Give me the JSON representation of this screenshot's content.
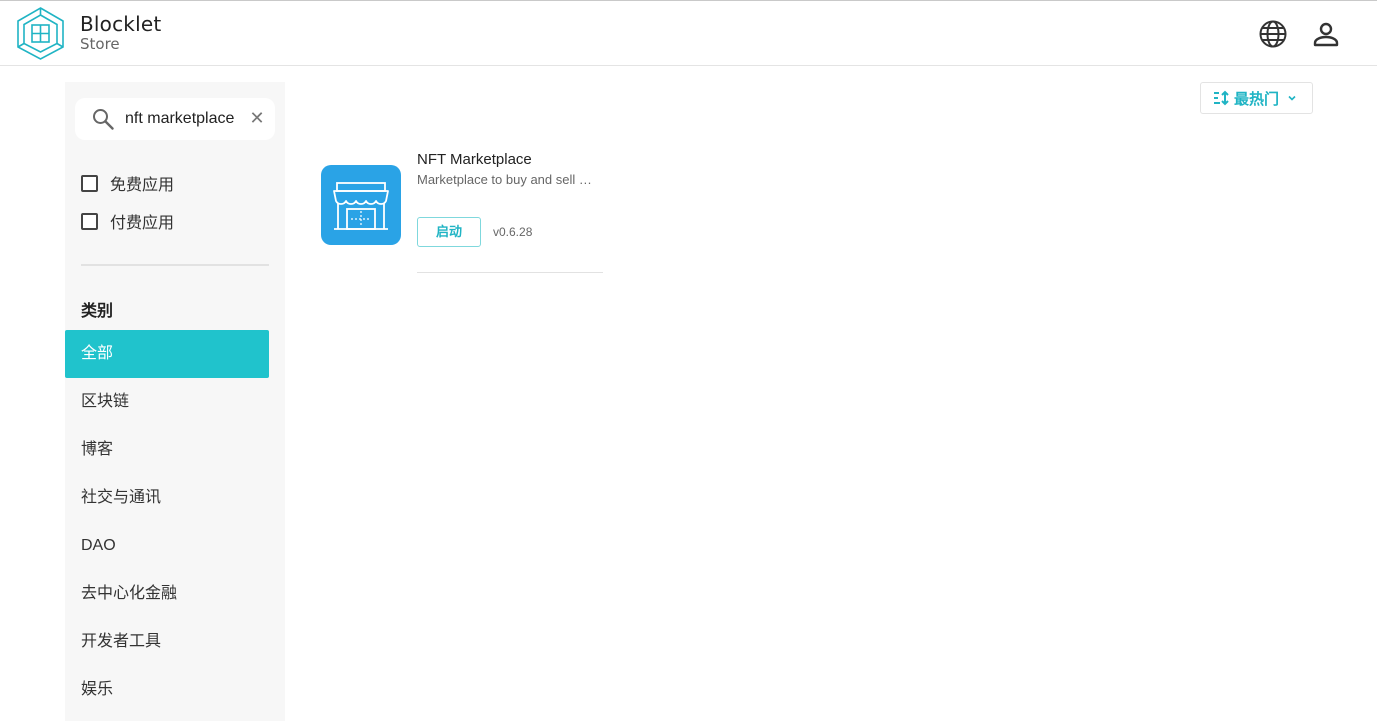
{
  "header": {
    "brand_name": "Blocklet",
    "brand_sub": "Store",
    "logo_icon": "blocklet-logo-icon",
    "accent_color": "#20c3cc"
  },
  "sidebar": {
    "search": {
      "value": "nft marketplace",
      "placeholder": ""
    },
    "filters": [
      {
        "label": "免费应用",
        "checked": false
      },
      {
        "label": "付费应用",
        "checked": false
      }
    ],
    "category_title": "类别",
    "categories": [
      {
        "label": "全部",
        "active": true
      },
      {
        "label": "区块链",
        "active": false
      },
      {
        "label": "博客",
        "active": false
      },
      {
        "label": "社交与通讯",
        "active": false
      },
      {
        "label": "DAO",
        "active": false
      },
      {
        "label": "去中心化金融",
        "active": false
      },
      {
        "label": "开发者工具",
        "active": false
      },
      {
        "label": "娱乐",
        "active": false
      }
    ]
  },
  "sort": {
    "label": "最热门"
  },
  "results": [
    {
      "name": "NFT Marketplace",
      "description": "Marketplace to buy and sell …",
      "action_label": "启动",
      "version": "v0.6.28",
      "icon": "storefront-icon",
      "icon_color": "#2aa3e6"
    }
  ]
}
